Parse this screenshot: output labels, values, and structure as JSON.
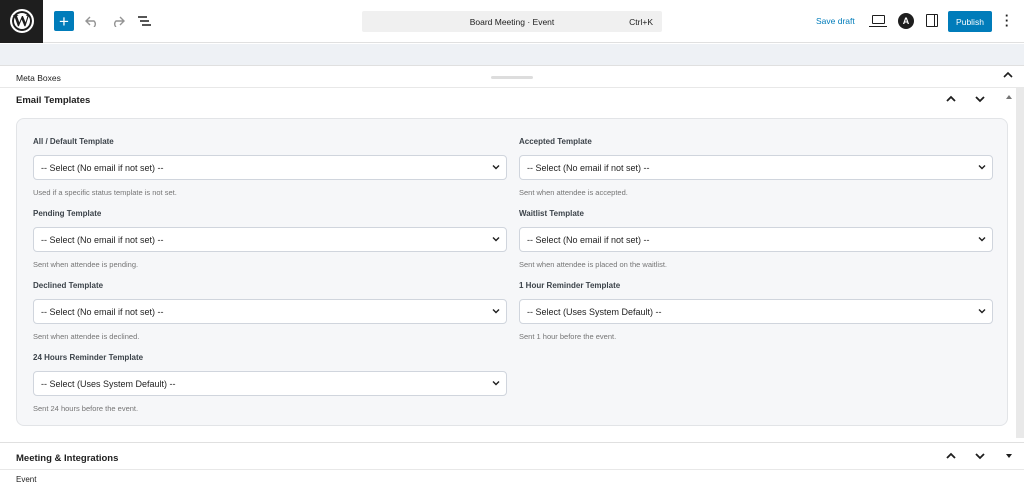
{
  "toolbar": {
    "logo": "W",
    "add_label": "+",
    "document_title": "Board Meeting · Event",
    "shortcut": "Ctrl+K",
    "save_draft": "Save draft",
    "astra_glyph": "A",
    "publish": "Publish",
    "icons": {
      "add": "plus-icon",
      "undo": "undo-icon",
      "redo": "redo-icon",
      "list_view": "list-view-icon",
      "preview": "laptop-preview-icon",
      "astra": "astra-settings-icon",
      "settings": "sidebar-settings-icon",
      "options": "more-vertical-icon"
    }
  },
  "meta_boxes": {
    "title": "Meta Boxes"
  },
  "email_templates": {
    "title": "Email Templates",
    "fields": [
      {
        "label": "All / Default Template",
        "value": "-- Select (No email if not set) --",
        "help": "Used if a specific status template is not set."
      },
      {
        "label": "Accepted Template",
        "value": "-- Select (No email if not set) --",
        "help": "Sent when attendee is accepted."
      },
      {
        "label": "Pending Template",
        "value": "-- Select (No email if not set) --",
        "help": "Sent when attendee is pending."
      },
      {
        "label": "Waitlist Template",
        "value": "-- Select (No email if not set) --",
        "help": "Sent when attendee is placed on the waitlist."
      },
      {
        "label": "Declined Template",
        "value": "-- Select (No email if not set) --",
        "help": "Sent when attendee is declined."
      },
      {
        "label": "1 Hour Reminder Template",
        "value": "-- Select (Uses System Default) --",
        "help": "Sent 1 hour before the event."
      },
      {
        "label": "24 Hours Reminder Template",
        "value": "-- Select (Uses System Default) --",
        "help": "Sent 24 hours before the event."
      }
    ]
  },
  "meeting": {
    "title": "Meeting & Integrations"
  },
  "footer": {
    "breadcrumb": "Event"
  },
  "colors": {
    "accent": "#007cba",
    "panel_bg": "#f6f7f9",
    "canvas_bg": "#eef1f5"
  }
}
